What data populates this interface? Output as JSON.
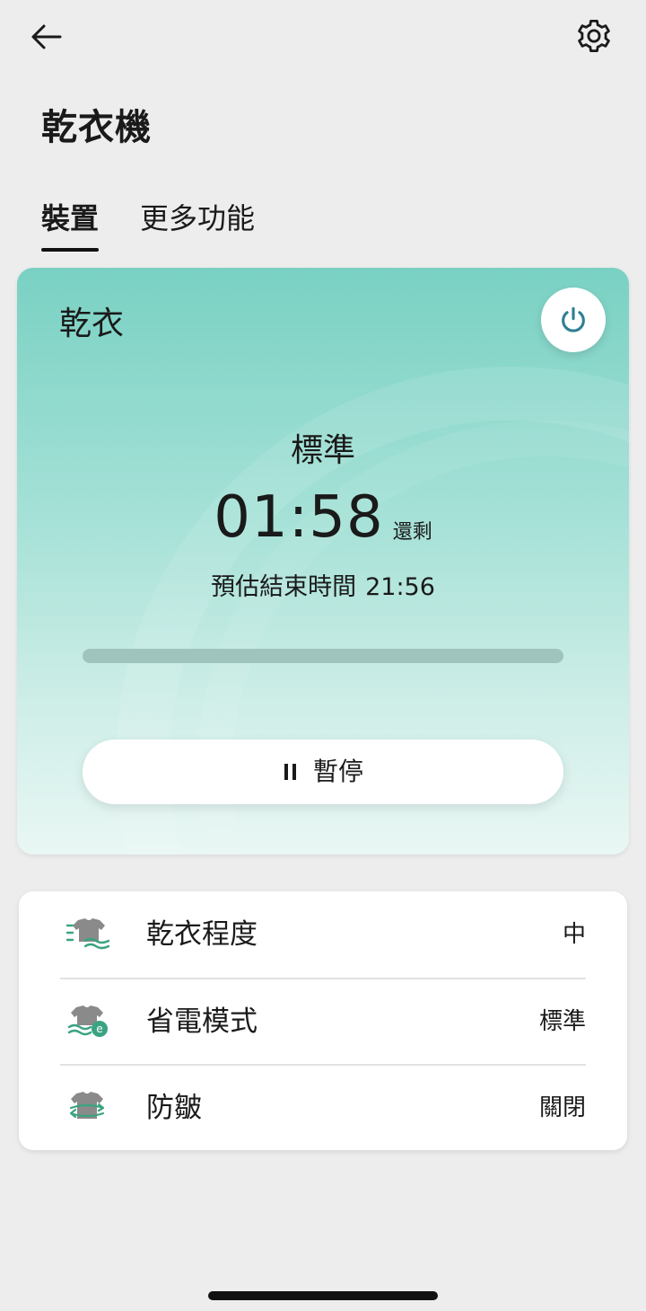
{
  "header": {
    "title": "乾衣機"
  },
  "tabs": [
    {
      "label": "裝置",
      "active": true
    },
    {
      "label": "更多功能",
      "active": false
    }
  ],
  "status": {
    "card_title": "乾衣",
    "mode": "標準",
    "remaining_time": "01:58",
    "remaining_suffix": "還剩",
    "end_label": "預估結束時間",
    "end_time": "21:56",
    "progress": 0.0,
    "pause_label": "暫停",
    "gradient_top": "#79d1c3",
    "gradient_bottom": "#e9f7f4"
  },
  "settings": [
    {
      "label": "乾衣程度",
      "value": "中",
      "icon": "shirt-dry-level-icon"
    },
    {
      "label": "省電模式",
      "value": "標準",
      "icon": "shirt-eco-icon"
    },
    {
      "label": "防皺",
      "value": "關閉",
      "icon": "shirt-anti-wrinkle-icon"
    }
  ],
  "colors": {
    "accent": "#3aa383",
    "power_icon": "#2e7f93",
    "background": "#ededed"
  }
}
